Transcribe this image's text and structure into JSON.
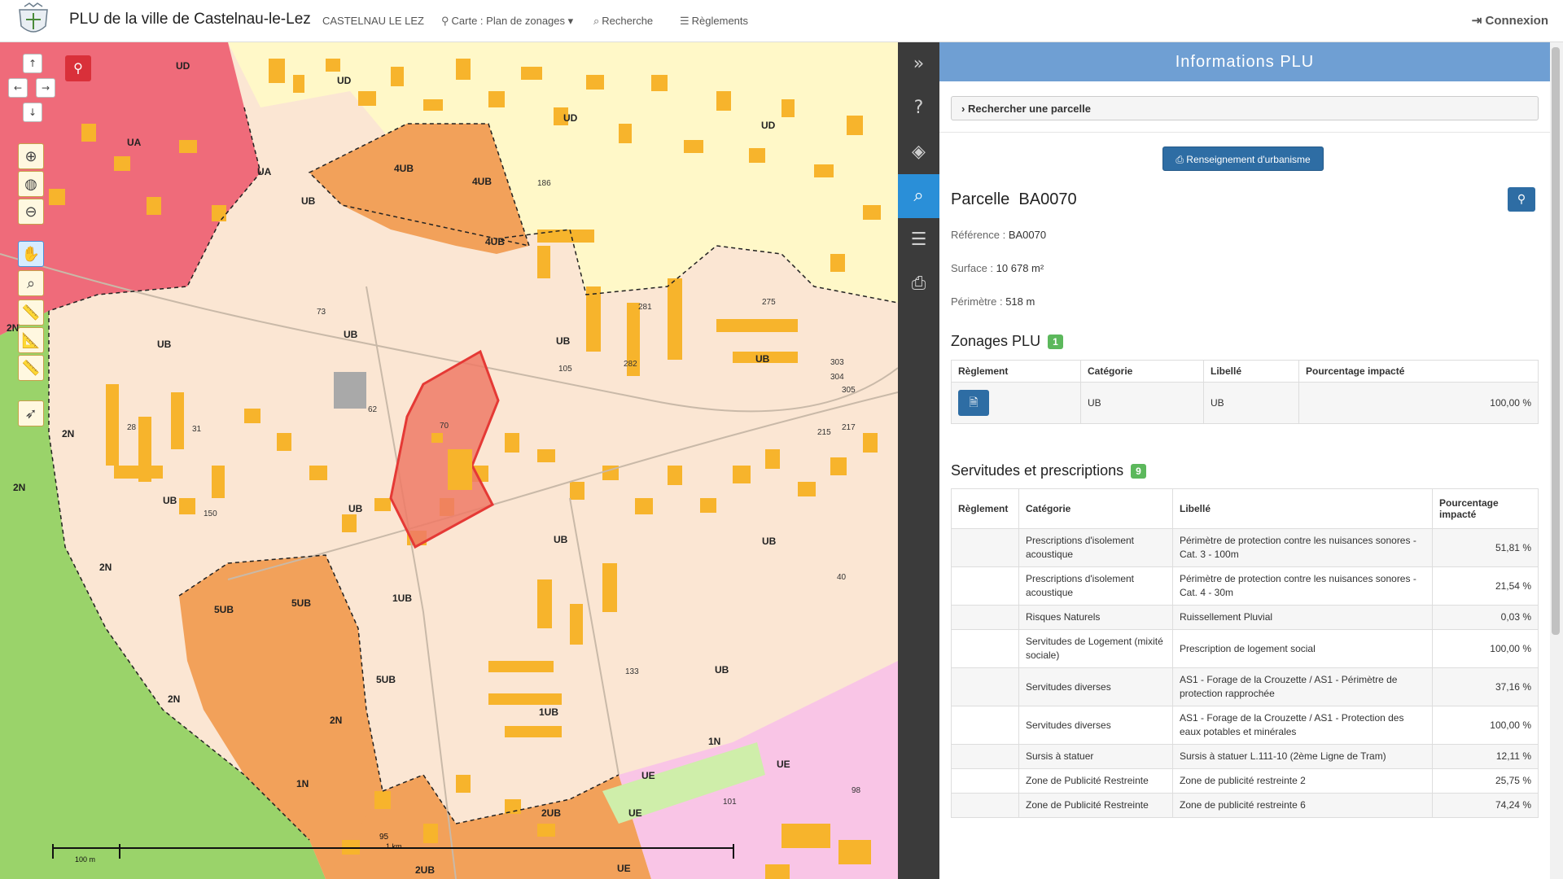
{
  "navbar": {
    "title": "PLU de la ville de Castelnau-le-Lez",
    "commune": "CASTELNAU LE LEZ",
    "map_menu": "Carte : Plan de zonages",
    "search": "Recherche",
    "rules": "Règlements",
    "login": "Connexion"
  },
  "map": {
    "zone_labels": [
      "UA",
      "UA",
      "UD",
      "UD",
      "UD",
      "UD",
      "4UB",
      "4UB",
      "4UB",
      "UB",
      "UB",
      "UB",
      "UB",
      "UB",
      "UB",
      "UB",
      "UB",
      "UB",
      "UB",
      "1UB",
      "1UB",
      "5UB",
      "5UB",
      "5UB",
      "2N",
      "2N",
      "2N",
      "2N",
      "2N",
      "2N",
      "1N",
      "1N",
      "UE",
      "UE",
      "UE",
      "2UB",
      "2UB",
      "UE"
    ],
    "numbers": [
      "70",
      "62",
      "73",
      "105",
      "282",
      "281",
      "275",
      "186",
      "150",
      "28",
      "31",
      "40",
      "133",
      "101",
      "98",
      "303",
      "304",
      "305",
      "215",
      "217"
    ],
    "scale_small": "100 m",
    "scale_big": "1 km",
    "scale_num": "95",
    "colors": {
      "ua": "#ef6b7a",
      "ub": "#fbe6d3",
      "ud": "#fff8c8",
      "n": "#9ad36a",
      "uub": "#f2a15a",
      "ue": "#f9c5e6",
      "building": "#f7b42c",
      "parcel": "#e53935"
    }
  },
  "sidebar": {
    "icons": [
      "double-chevron-right-icon",
      "help-icon",
      "layers-icon",
      "search-icon",
      "list-icon",
      "print-icon"
    ]
  },
  "panel": {
    "header": "Informations PLU",
    "search_parcel": "Rechercher une parcelle",
    "urbanisme_button": "Renseignement d'urbanisme",
    "parcel_label": "Parcelle",
    "parcel_id": "BA0070",
    "reference_label": "Référence :",
    "reference_value": "BA0070",
    "surface_label": "Surface :",
    "surface_value": "10 678 m²",
    "perimetre_label": "Périmètre :",
    "perimetre_value": "518 m",
    "zonages_title": "Zonages PLU",
    "zonages_count": "1",
    "zonages_headers": [
      "Règlement",
      "Catégorie",
      "Libellé",
      "Pourcentage impacté"
    ],
    "zonages_rows": [
      {
        "categorie": "UB",
        "libelle": "UB",
        "pourcentage": "100,00 %"
      }
    ],
    "servitudes_title": "Servitudes et prescriptions",
    "servitudes_count": "9",
    "servitudes_headers": [
      "Règlement",
      "Catégorie",
      "Libellé",
      "Pourcentage impacté"
    ],
    "servitudes_rows": [
      {
        "categorie": "Prescriptions d'isolement acoustique",
        "libelle": "Périmètre de protection contre les nuisances sonores - Cat. 3 - 100m",
        "pourcentage": "51,81 %"
      },
      {
        "categorie": "Prescriptions d'isolement acoustique",
        "libelle": "Périmètre de protection contre les nuisances sonores - Cat. 4 - 30m",
        "pourcentage": "21,54 %"
      },
      {
        "categorie": "Risques Naturels",
        "libelle": "Ruissellement Pluvial",
        "pourcentage": "0,03 %"
      },
      {
        "categorie": "Servitudes de Logement (mixité sociale)",
        "libelle": "Prescription de logement social",
        "pourcentage": "100,00 %"
      },
      {
        "categorie": "Servitudes diverses",
        "libelle": "AS1 - Forage de la Crouzette / AS1 - Périmètre de protection rapprochée",
        "pourcentage": "37,16 %"
      },
      {
        "categorie": "Servitudes diverses",
        "libelle": "AS1 - Forage de la Crouzette / AS1 - Protection des eaux potables et minérales",
        "pourcentage": "100,00 %"
      },
      {
        "categorie": "Sursis à statuer",
        "libelle": "Sursis à statuer L.111-10 (2ème Ligne de Tram)",
        "pourcentage": "12,11 %"
      },
      {
        "categorie": "Zone de Publicité Restreinte",
        "libelle": "Zone de publicité restreinte 2",
        "pourcentage": "25,75 %"
      },
      {
        "categorie": "Zone de Publicité Restreinte",
        "libelle": "Zone de publicité restreinte 6",
        "pourcentage": "74,24 %"
      }
    ]
  }
}
